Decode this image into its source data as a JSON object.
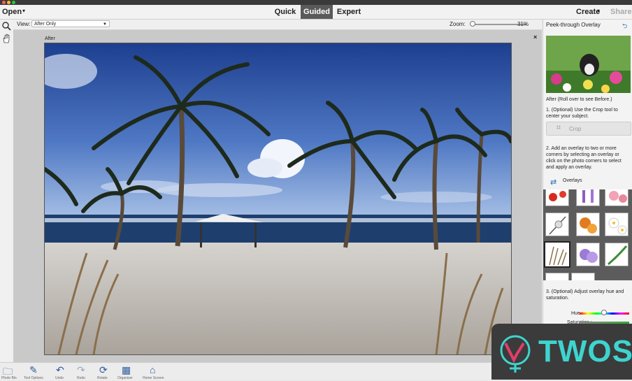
{
  "menubar": {
    "open_label": "Open",
    "caret": "▾",
    "tabs": [
      {
        "label": "Quick",
        "active": false
      },
      {
        "label": "Guided",
        "active": true
      },
      {
        "label": "Expert",
        "active": false
      }
    ],
    "create_label": "Create",
    "share_label": "Share"
  },
  "viewbar": {
    "view_label": "View:",
    "view_value": "After Only",
    "zoom_label": "Zoom:",
    "zoom_value": "31%",
    "zoom_fraction": 0.05
  },
  "canvas": {
    "after_label": "After",
    "close_symbol": "×"
  },
  "panel": {
    "title": "Peek-through Overlay",
    "preview_caption": "After (Roll over to see Before.)",
    "step1": "1. (Optional) Use the Crop tool to center your subject.",
    "crop_label": "Crop",
    "step2": "2. Add an overlay to two or more corners by selecting an overlay or click on the photo corners to select and apply an overlay.",
    "overlays_label": "Overlays",
    "step3": "3. (Optional) Adjust overlay hue and saturation.",
    "hue_label": "Hue :",
    "saturation_label": "Saturation :"
  },
  "bottombar": {
    "labels": [
      "Photo Bin",
      "Tool Options",
      "Undo",
      "Redo",
      "Rotate",
      "Organizer",
      "Home Screen"
    ]
  },
  "watermark": {
    "text": "TWOS"
  },
  "colors": {
    "accent": "#2a6fb5",
    "watermark_teal": "#3ed4cf",
    "active_tab": "#5a5a5a"
  }
}
